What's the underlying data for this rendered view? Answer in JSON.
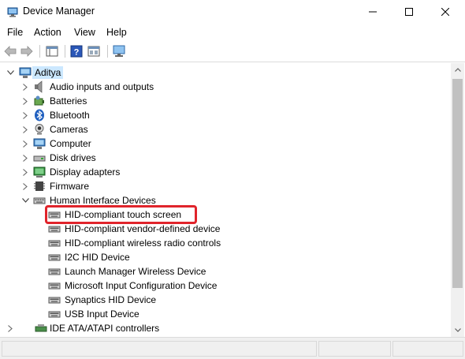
{
  "window": {
    "title": "Device Manager"
  },
  "menu": [
    "File",
    "Action",
    "View",
    "Help"
  ],
  "toolbar": [
    "back-icon",
    "forward-icon",
    "properties-window-icon",
    "help-icon",
    "update-driver-icon",
    "scan-hardware-icon"
  ],
  "tree": {
    "root": "Aditya",
    "categories": [
      {
        "label": "Audio inputs and outputs",
        "icon": "speaker-icon"
      },
      {
        "label": "Batteries",
        "icon": "battery-icon"
      },
      {
        "label": "Bluetooth",
        "icon": "bluetooth-icon"
      },
      {
        "label": "Cameras",
        "icon": "camera-icon"
      },
      {
        "label": "Computer",
        "icon": "computer-icon"
      },
      {
        "label": "Disk drives",
        "icon": "disk-drive-icon"
      },
      {
        "label": "Display adapters",
        "icon": "display-adapter-icon"
      },
      {
        "label": "Firmware",
        "icon": "firmware-icon"
      },
      {
        "label": "Human Interface Devices",
        "icon": "hid-icon",
        "expanded": true
      }
    ],
    "hid_children": [
      "HID-compliant touch screen",
      "HID-compliant vendor-defined device",
      "HID-compliant wireless radio controls",
      "I2C HID Device",
      "Launch Manager Wireless Device",
      "Microsoft Input Configuration Device",
      "Synaptics HID Device",
      "USB Input Device"
    ],
    "after": [
      {
        "label": "IDE ATA/ATAPI controllers",
        "icon": "ide-controller-icon"
      }
    ]
  },
  "highlight_color": "#e0242b",
  "selection_color": "#cce8ff"
}
